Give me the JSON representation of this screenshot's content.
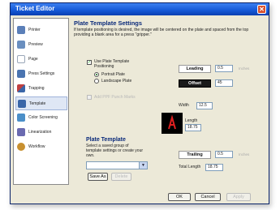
{
  "window": {
    "title": "Ticket Editor"
  },
  "sidebar": {
    "items": [
      {
        "label": "Printer",
        "icon": "printer-icon",
        "color": "#5b7fb8"
      },
      {
        "label": "Preview",
        "icon": "preview-icon",
        "color": "#6a8fbf"
      },
      {
        "label": "Page",
        "icon": "page-icon",
        "color": "#9aa7b8"
      },
      {
        "label": "Press Settings",
        "icon": "press-settings-icon",
        "color": "#4a74b0"
      },
      {
        "label": "Trapping",
        "icon": "trapping-icon",
        "color": "#c04040"
      },
      {
        "label": "Template",
        "icon": "template-icon",
        "color": "#3a66a8",
        "selected": true
      },
      {
        "label": "Color Screening",
        "icon": "color-screening-icon",
        "color": "#4b8fc8"
      },
      {
        "label": "Linearization",
        "icon": "linearization-icon",
        "color": "#6a6ab0"
      },
      {
        "label": "Workflow",
        "icon": "workflow-icon",
        "color": "#c89030"
      }
    ]
  },
  "main": {
    "heading": "Plate Template Settings",
    "description": "If template positioning is desired, the image will be centered on the plate and spaced from the top providing a blank area for a press \"gripper.\"",
    "use_template": {
      "label": "Use Plate Template Positioning",
      "checked": true
    },
    "orientation": {
      "options": [
        "Portrait Plate",
        "Landscape Plate"
      ],
      "selected": "Portrait Plate"
    },
    "add_ppf": {
      "label": "Add PPF Punch Marks"
    },
    "leading": {
      "label": "Leading",
      "value": "0.5",
      "unit": "Inches"
    },
    "offset": {
      "label": "Offset",
      "value": "45"
    },
    "width": {
      "label": "Width",
      "value": "12.5"
    },
    "length": {
      "label": "Length",
      "value": "18.75"
    },
    "trailing": {
      "label": "Trailing",
      "value": "0.5",
      "unit": "Inches"
    },
    "total_length": {
      "label": "Total Length",
      "value": "18.75"
    },
    "plate_template": {
      "heading": "Plate Template",
      "description": "Select a saved group of template settings or create your own.",
      "save_as": "Save As",
      "delete": "Delete"
    }
  },
  "footer": {
    "ok": "OK",
    "cancel": "Cancel",
    "apply": "Apply"
  },
  "colors": {
    "title_bar": "#1458d6",
    "heading": "#0a2a7a",
    "close": "#d8502c",
    "preview_bg": "#000000",
    "preview_accent": "#e02020"
  }
}
